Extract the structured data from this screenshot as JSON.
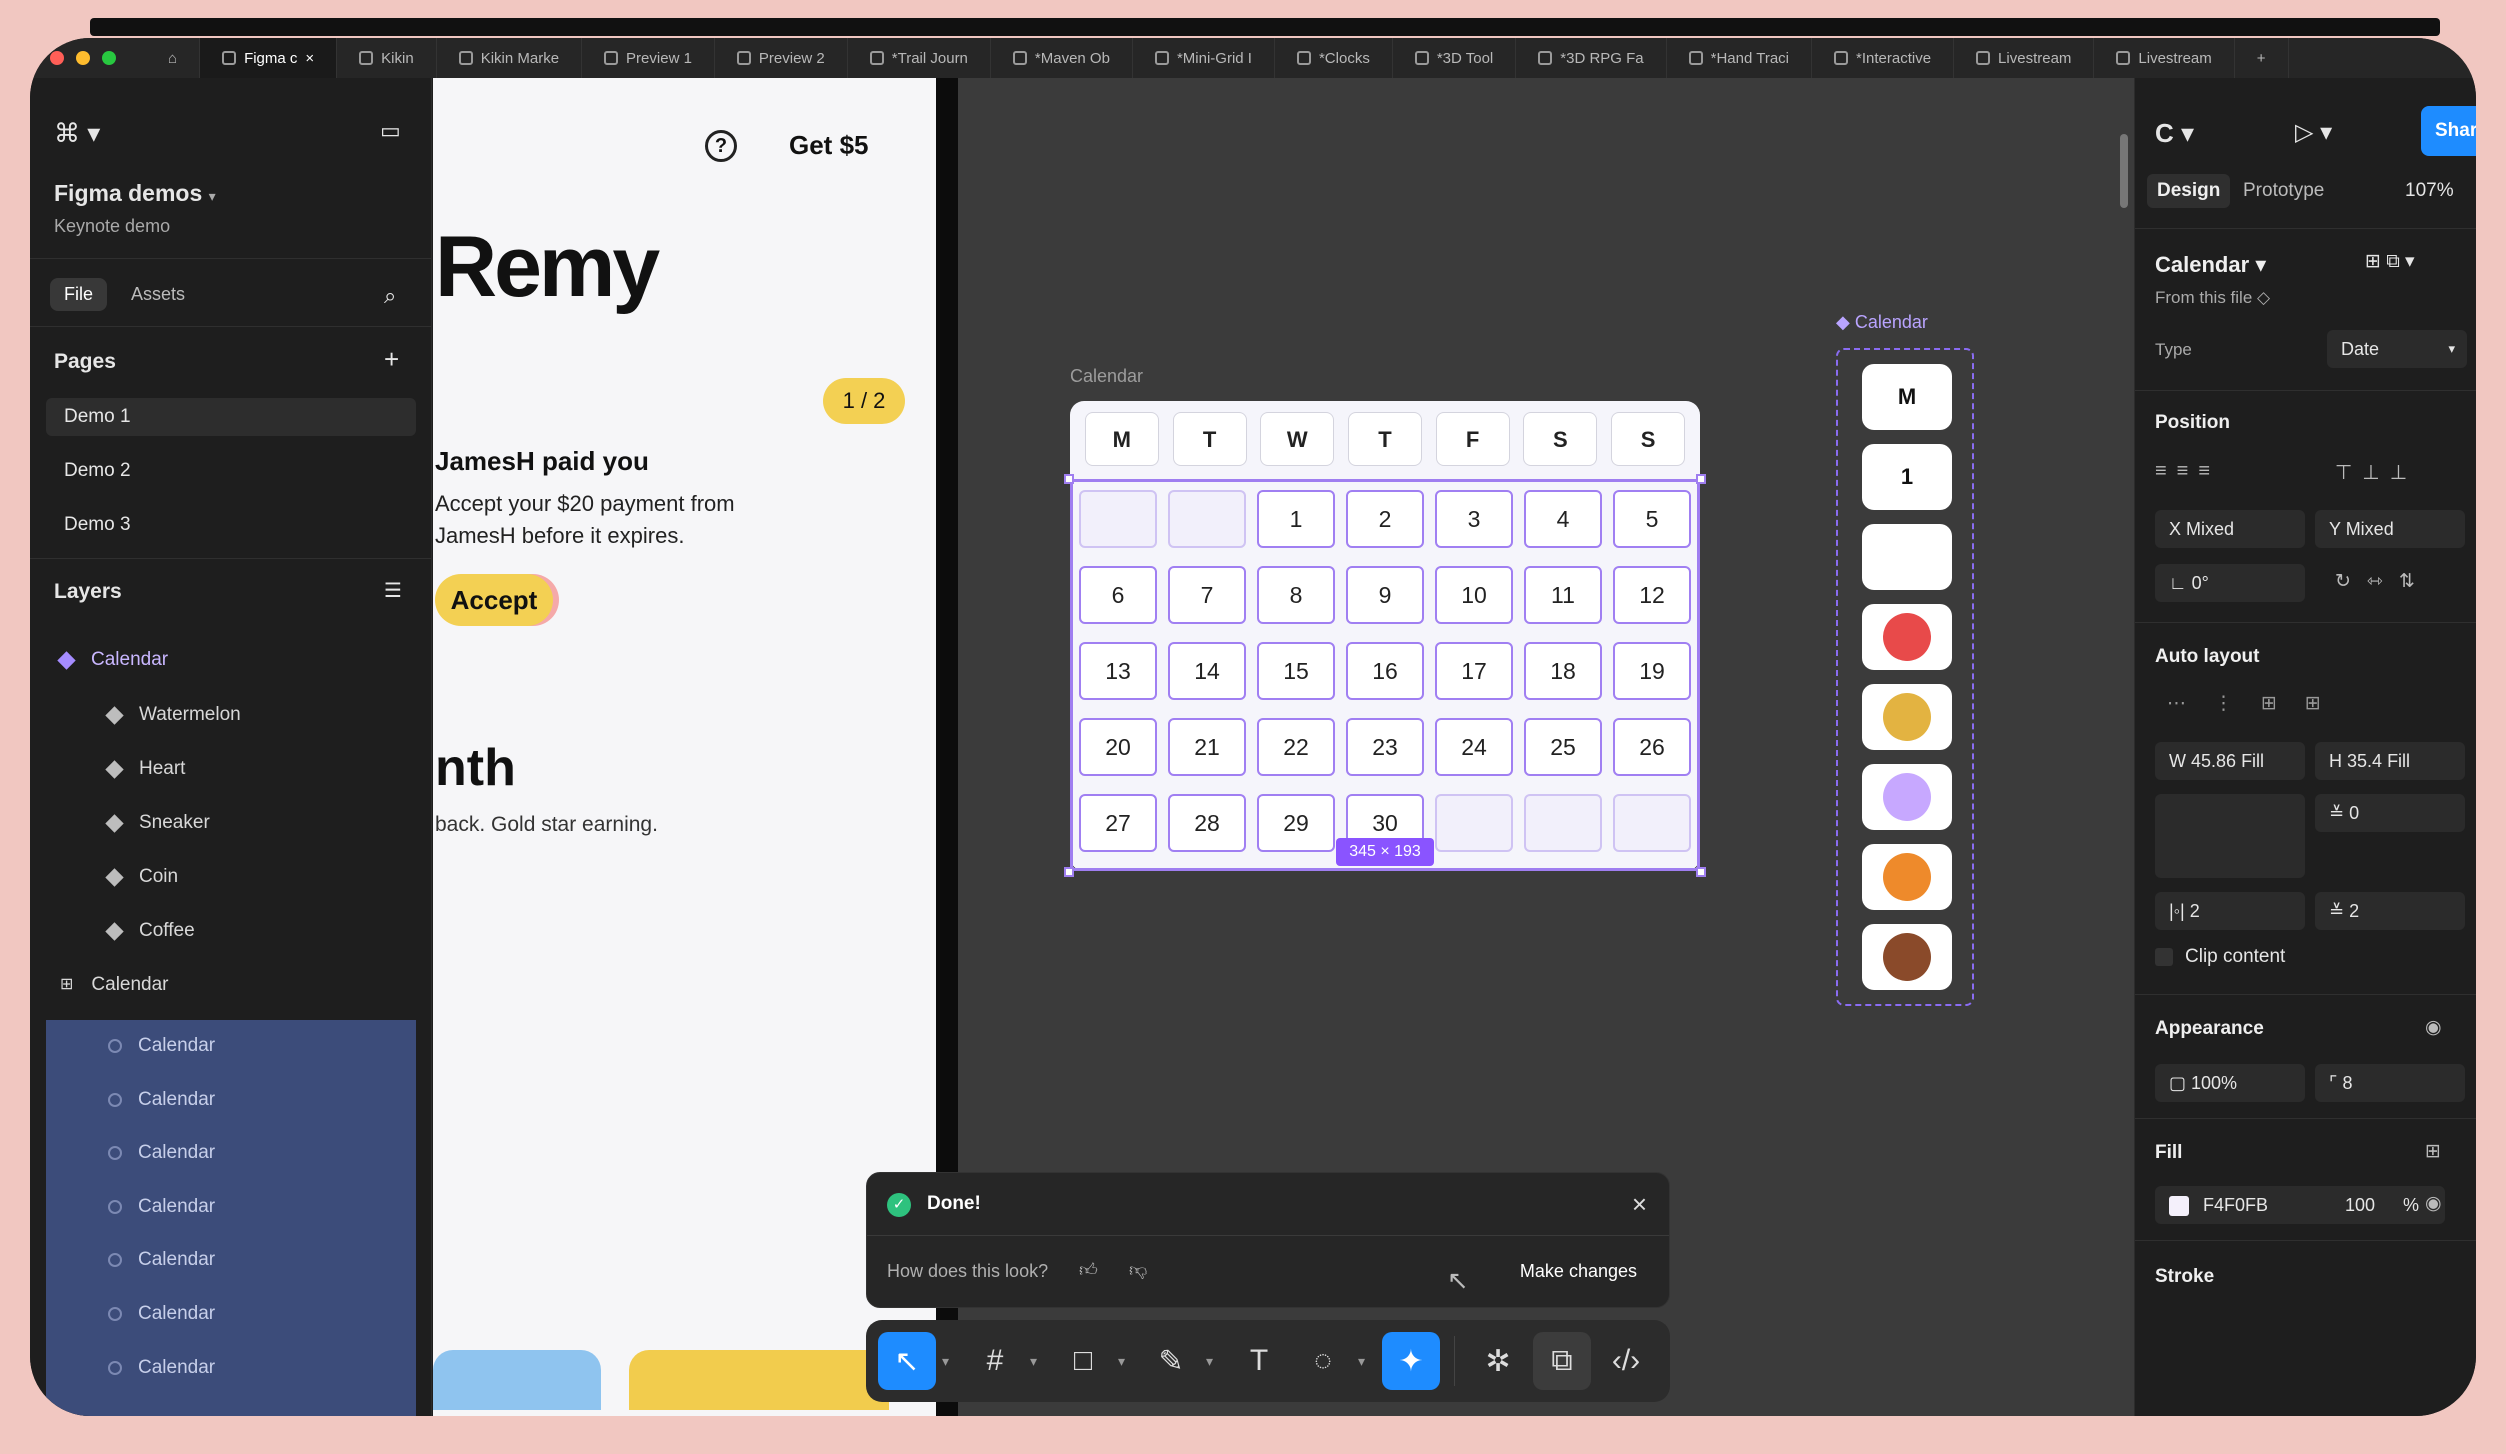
{
  "tabs": [
    {
      "label": "Figma c",
      "active": true
    },
    {
      "label": "Kikin"
    },
    {
      "label": "Kikin Marke"
    },
    {
      "label": "Preview 1"
    },
    {
      "label": "Preview 2"
    },
    {
      "label": "*Trail Journ"
    },
    {
      "label": "*Maven Ob"
    },
    {
      "label": "*Mini-Grid I"
    },
    {
      "label": "*Clocks"
    },
    {
      "label": "*3D Tool"
    },
    {
      "label": "*3D RPG Fa"
    },
    {
      "label": "*Hand Traci"
    },
    {
      "label": "*Interactive"
    },
    {
      "label": "Livestream"
    },
    {
      "label": "Livestream"
    }
  ],
  "left": {
    "project": "Figma demos",
    "file": "Keynote demo",
    "seg_file": "File",
    "seg_assets": "Assets",
    "pages_title": "Pages",
    "pages": [
      "Demo 1",
      "Demo 2",
      "Demo 3"
    ],
    "layers_title": "Layers",
    "layers": [
      {
        "label": "Calendar",
        "kind": "component"
      },
      {
        "label": "Watermelon"
      },
      {
        "label": "Heart"
      },
      {
        "label": "Sneaker"
      },
      {
        "label": "Coin"
      },
      {
        "label": "Coffee"
      },
      {
        "label": "Calendar",
        "kind": "frame"
      }
    ],
    "selected_layers": [
      "Calendar",
      "Calendar",
      "Calendar",
      "Calendar",
      "Calendar",
      "Calendar",
      "Calendar"
    ]
  },
  "preview": {
    "get": "Get $5",
    "name": "Remy",
    "badge": "1 / 2",
    "paid": "JamesH paid you",
    "desc": "Accept your $20 payment from JamesH before it expires.",
    "accept": "Accept",
    "month": "nth",
    "back": "back. Gold star earning."
  },
  "canvas": {
    "frame_label": "Calendar",
    "weekdays": [
      "M",
      "T",
      "W",
      "T",
      "F",
      "S",
      "S"
    ],
    "days": [
      "",
      "",
      "1",
      "2",
      "3",
      "4",
      "5",
      "6",
      "7",
      "8",
      "9",
      "10",
      "11",
      "12",
      "13",
      "14",
      "15",
      "16",
      "17",
      "18",
      "19",
      "20",
      "21",
      "22",
      "23",
      "24",
      "25",
      "26",
      "27",
      "28",
      "29",
      "30",
      "",
      "",
      ""
    ],
    "dimensions": "345 × 193",
    "stack_label": "Calendar",
    "stack_items": [
      {
        "text": "M"
      },
      {
        "text": "1"
      },
      {
        "text": ""
      },
      {
        "icon": "watermelon-icon",
        "color": "#e84a4a"
      },
      {
        "icon": "heart-icon",
        "color": "#e3b341"
      },
      {
        "icon": "sneaker-icon",
        "color": "#c7a8ff"
      },
      {
        "icon": "coin-icon",
        "color": "#ee8a2b"
      },
      {
        "icon": "coffee-icon",
        "color": "#8a4a2a"
      }
    ]
  },
  "toast": {
    "title": "Done!",
    "question": "How does this look?",
    "make_changes": "Make changes"
  },
  "right": {
    "share": "Share",
    "tab_design": "Design",
    "tab_prototype": "Prototype",
    "zoom": "107%",
    "component": "Calendar",
    "from_file": "From this file",
    "type_label": "Type",
    "type_value": "Date",
    "position": "Position",
    "x": "Mixed",
    "y": "Mixed",
    "rotation": "0°",
    "auto_layout": "Auto layout",
    "w": "45.86",
    "w_mode": "Fill",
    "h": "35.4",
    "h_mode": "Fill",
    "gap": "0",
    "pad_h": "2",
    "pad_v": "2",
    "clip": "Clip content",
    "appearance": "Appearance",
    "opacity": "100%",
    "radius": "8",
    "fill": "Fill",
    "fill_hex": "F4F0FB",
    "fill_opacity": "100",
    "fill_pct": "%",
    "stroke": "Stroke"
  },
  "colors": {
    "accent": "#1e8cff",
    "selection": "#9f7ef0",
    "yellow": "#f3d053"
  }
}
